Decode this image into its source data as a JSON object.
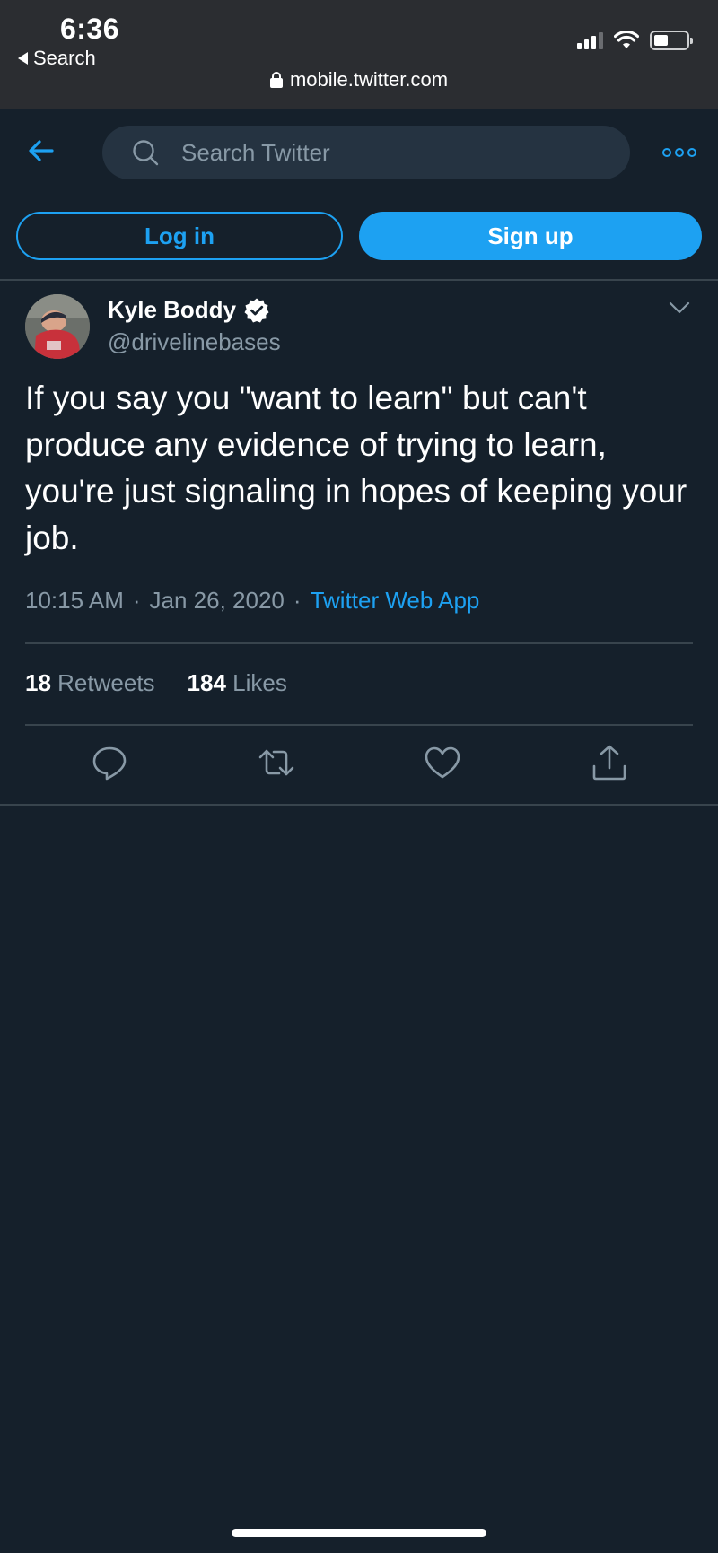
{
  "status_bar": {
    "time": "6:36",
    "back_app_label": "Search",
    "url": "mobile.twitter.com"
  },
  "header": {
    "search_placeholder": "Search Twitter",
    "login_label": "Log in",
    "signup_label": "Sign up",
    "accent_color": "#1da1f2"
  },
  "tweet": {
    "author_name": "Kyle Boddy",
    "handle": "@drivelinebases",
    "verified": true,
    "text": "If you say you \"want to learn\" but can't produce any evidence of trying to learn, you're just signaling in hopes of keeping your job.",
    "time": "10:15 AM",
    "separator": "·",
    "date": "Jan 26, 2020",
    "source": "Twitter Web App",
    "retweets_count": "18",
    "retweets_label": "Retweets",
    "likes_count": "184",
    "likes_label": "Likes"
  },
  "icons": {
    "back": "arrow-left-icon",
    "search": "search-icon",
    "more": "more-icon",
    "caret": "chevron-down-icon",
    "reply": "reply-icon",
    "retweet": "retweet-icon",
    "like": "heart-icon",
    "share": "share-icon"
  }
}
